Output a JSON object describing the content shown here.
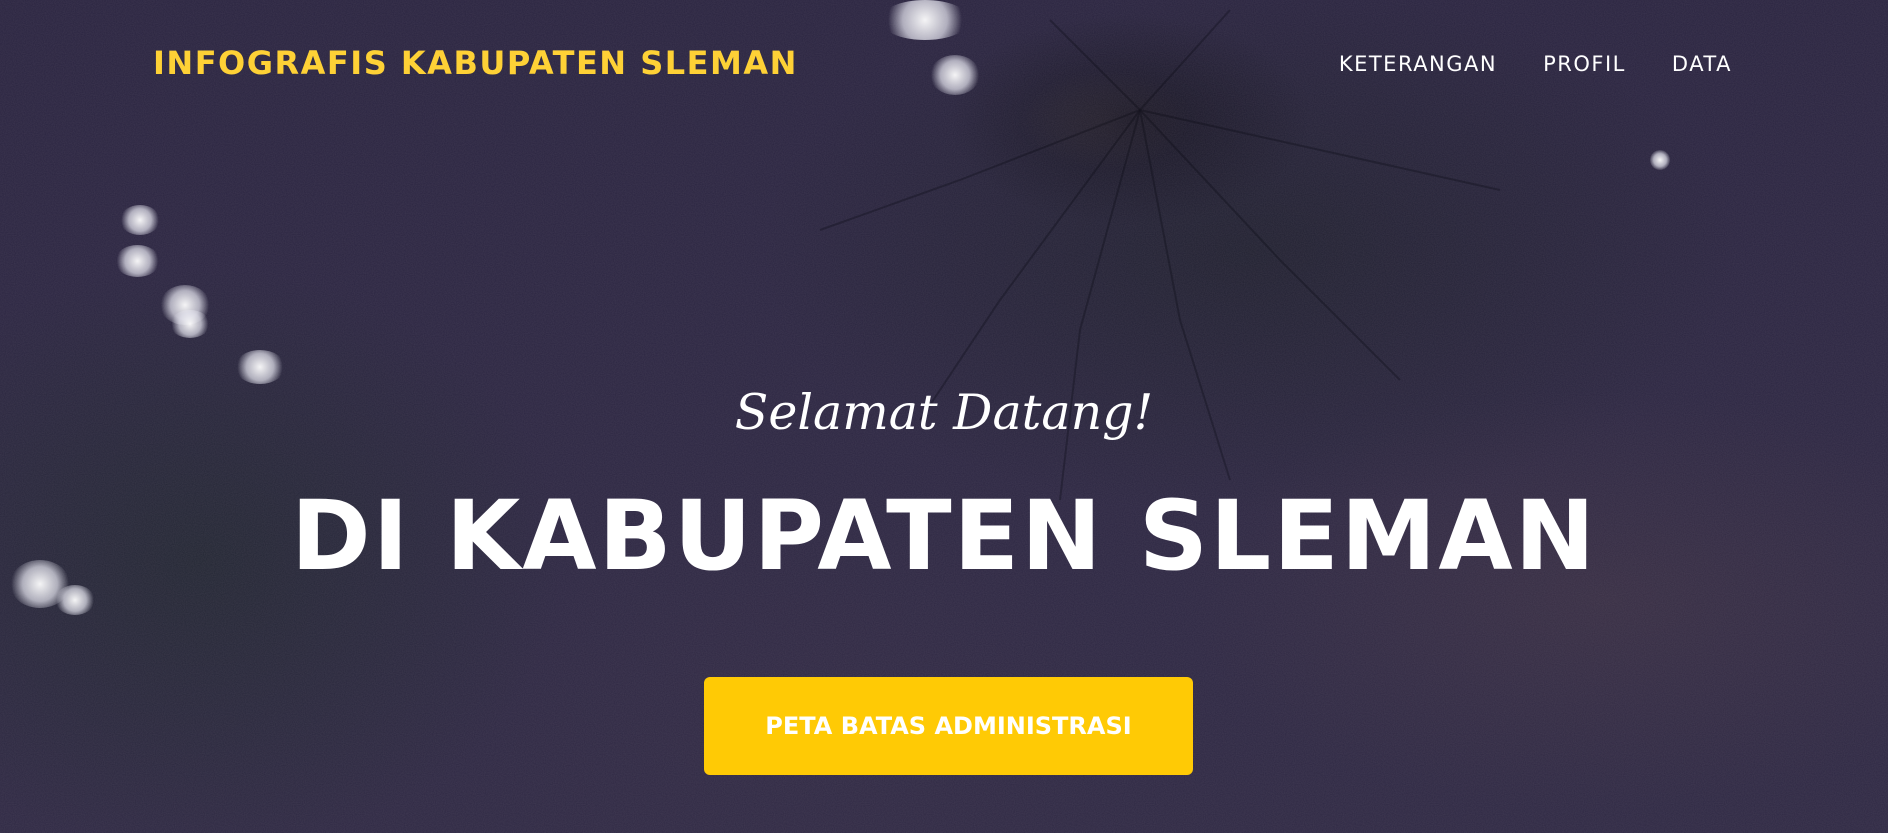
{
  "header": {
    "brand": "INFOGRAFIS KABUPATEN SLEMAN",
    "nav": [
      {
        "label": "KETERANGAN"
      },
      {
        "label": "PROFIL"
      },
      {
        "label": "DATA"
      }
    ]
  },
  "hero": {
    "welcome": "Selamat Datang!",
    "headline": "DI KABUPATEN SLEMAN",
    "cta_label": "PETA BATAS ADMINISTRASI"
  },
  "colors": {
    "accent": "#fed136",
    "button": "#ffca05",
    "text": "#ffffff",
    "background": "#2a2440"
  },
  "background_image": "satellite-view-mount-merapi"
}
